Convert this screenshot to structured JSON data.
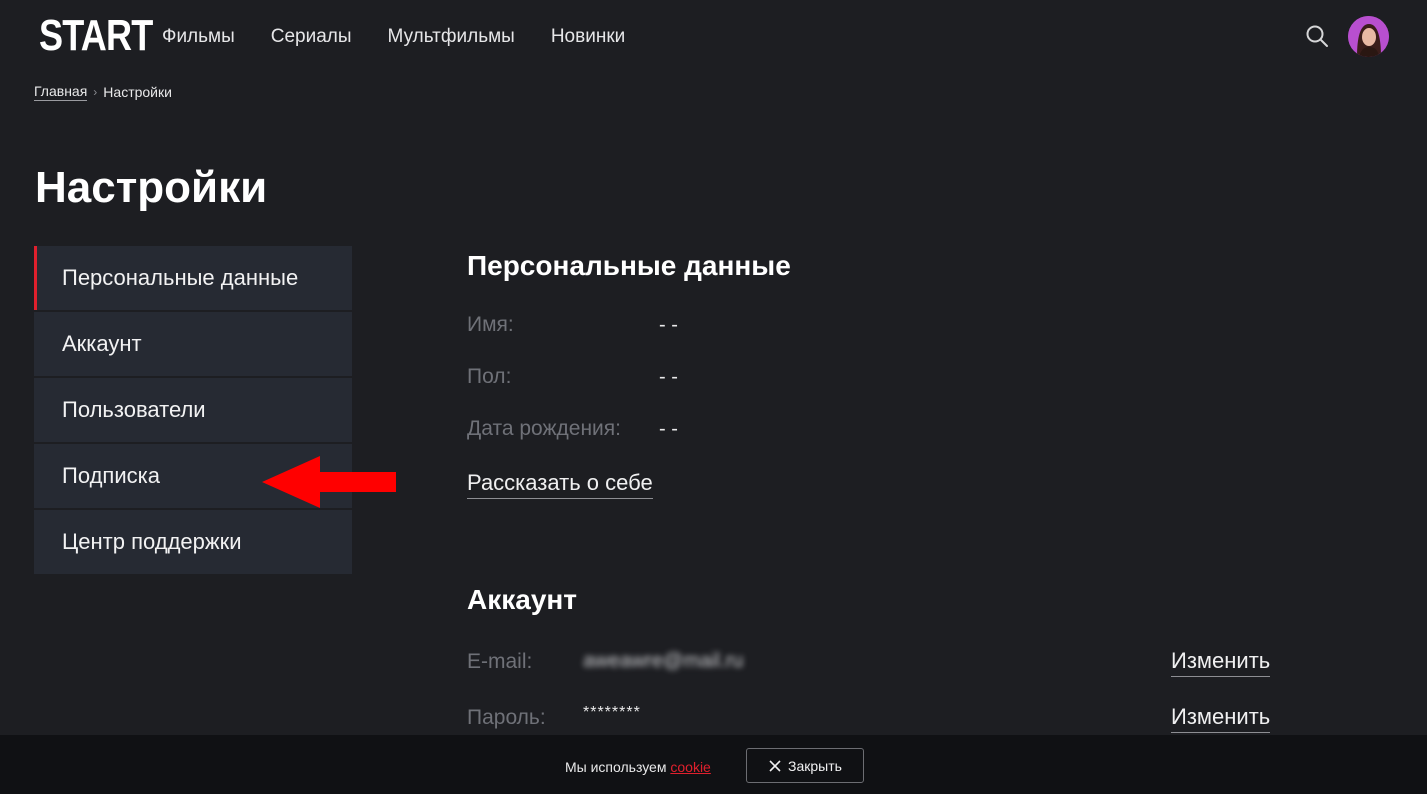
{
  "header": {
    "logo": "START",
    "nav": [
      "Фильмы",
      "Сериалы",
      "Мультфильмы",
      "Новинки"
    ]
  },
  "breadcrumb": {
    "home": "Главная",
    "separator": "›",
    "current": "Настройки"
  },
  "page_title": "Настройки",
  "sidebar": {
    "items": [
      {
        "label": "Персональные данные",
        "active": true
      },
      {
        "label": "Аккаунт"
      },
      {
        "label": "Пользователи"
      },
      {
        "label": "Подписка"
      },
      {
        "label": "Центр поддержки"
      }
    ]
  },
  "personal": {
    "title": "Персональные данные",
    "name_label": "Имя:",
    "name_value": "- -",
    "gender_label": "Пол:",
    "gender_value": "- -",
    "birth_label": "Дата рождения:",
    "birth_value": "- -",
    "about_link": "Рассказать о себе"
  },
  "account": {
    "title": "Аккаунт",
    "email_label": "E-mail:",
    "email_value": "aweawre@mail.ru",
    "email_change": "Изменить",
    "password_label": "Пароль:",
    "password_value": "********",
    "password_change": "Изменить"
  },
  "cookie": {
    "text": "Мы используем",
    "link": "cookie",
    "close": "Закрыть"
  },
  "colors": {
    "accent": "#e0202d",
    "background": "#1d1e22",
    "sidebar_item": "#262a33"
  }
}
